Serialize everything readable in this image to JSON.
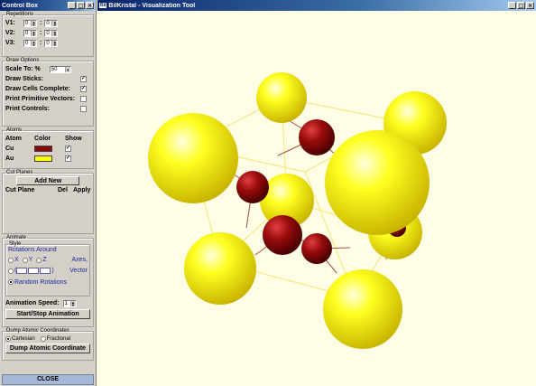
{
  "control_box": {
    "title": "Control Box",
    "repetitions": {
      "legend": "Repetitions",
      "rows": [
        {
          "label": "V1:",
          "from": "0",
          "to": "0"
        },
        {
          "label": "V2:",
          "from": "0",
          "to": "0"
        },
        {
          "label": "V3:",
          "from": "0",
          "to": "0"
        }
      ],
      "separator": ":"
    },
    "draw_options": {
      "legend": "Draw Options",
      "scale_label": "Scale To: %",
      "scale_value": "50",
      "draw_sticks": "Draw Sticks:",
      "draw_cells": "Draw Cells Complete:",
      "print_vectors": "Print Primitive Vectors:",
      "print_controls": "Print Controls:"
    },
    "atoms": {
      "legend": "Atoms",
      "headers": [
        "Atom",
        "Color",
        "Show"
      ],
      "items": [
        {
          "name": "Cu",
          "color": "#8b0a0a"
        },
        {
          "name": "Au",
          "color": "#ffff00"
        }
      ]
    },
    "cut_planes": {
      "legend": "Cut Planes",
      "add_new": "Add New",
      "col_plane": "Cut Plane",
      "col_del": "Del",
      "col_apply": "Apply"
    },
    "animate": {
      "legend": "Animate",
      "style_legend": "Style",
      "rotations_around": "Rotations Around",
      "x": "X",
      "y": "Y",
      "z": "Z",
      "axes": "Axes,",
      "vector": "Vector",
      "random": "Random Rotations",
      "speed_label": "Animation Speed:",
      "speed_value": "1",
      "start_stop": "Start/Stop Animation"
    },
    "dump": {
      "legend": "Dump Atomic Coordinates",
      "cartesian": "Cartesian",
      "fractional": "Fractional",
      "button": "Dump Atomic Coordinate"
    },
    "close": "CLOSE"
  },
  "viz": {
    "title": "BilKristal - Visualization Tool",
    "app_badge": "Bil",
    "colors": {
      "cu": "#8b0a0a",
      "au": "#ffff00",
      "background": "#fffde6"
    }
  }
}
